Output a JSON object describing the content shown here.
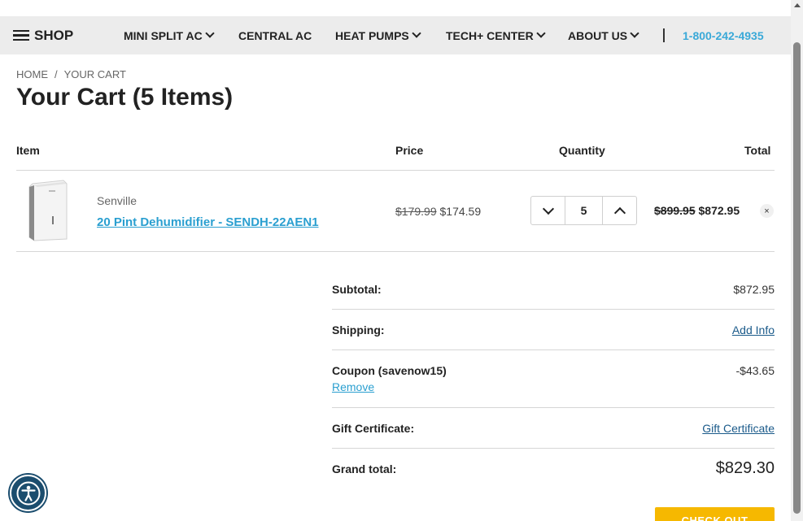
{
  "nav": {
    "shop_label": "SHOP",
    "items": [
      {
        "label": "MINI SPLIT AC",
        "dropdown": true
      },
      {
        "label": "CENTRAL AC",
        "dropdown": false
      },
      {
        "label": "HEAT PUMPS",
        "dropdown": true
      },
      {
        "label": "TECH+ CENTER",
        "dropdown": true
      },
      {
        "label": "ABOUT US",
        "dropdown": true
      }
    ],
    "phone": "1-800-242-4935"
  },
  "breadcrumb": [
    "HOME",
    "YOUR CART"
  ],
  "page_title": "Your Cart (5 Items)",
  "table": {
    "headers": {
      "item": "Item",
      "price": "Price",
      "quantity": "Quantity",
      "total": "Total"
    }
  },
  "cart_item": {
    "brand": "Senville",
    "name": "20 Pint Dehumidifier - SENDH-22AEN1",
    "old_price": "$179.99",
    "price": "$174.59",
    "quantity": "5",
    "old_total": "$899.95",
    "total": "$872.95",
    "remove_glyph": "×"
  },
  "summary": {
    "subtotal_label": "Subtotal:",
    "subtotal_value": "$872.95",
    "shipping_label": "Shipping:",
    "shipping_link": "Add Info",
    "coupon_label": "Coupon (savenow15)",
    "coupon_value": "-$43.65",
    "coupon_remove": "Remove",
    "gift_label": "Gift Certificate:",
    "gift_link": "Gift Certificate",
    "grand_label": "Grand total:",
    "grand_value": "$829.30"
  },
  "checkout_label": "CHECK OUT",
  "colors": {
    "accent": "#3aa9d8",
    "link": "#2a9fd0",
    "checkout": "#f6b800",
    "a11y": "#1b4d6e"
  }
}
